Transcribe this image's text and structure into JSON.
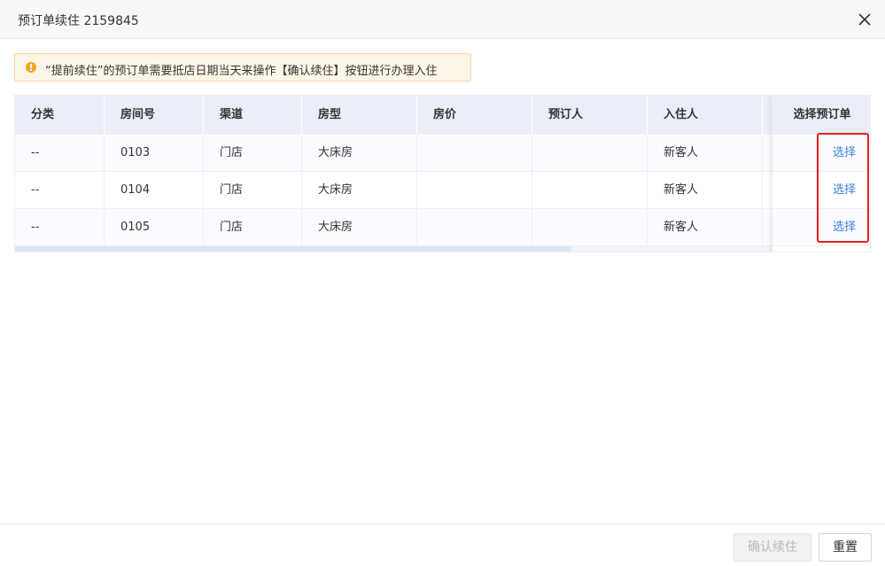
{
  "dialog": {
    "title": "预订单续住 2159845"
  },
  "alert": {
    "text": "“提前续住”的预订单需要抵店日期当天来操作【确认续住】按钮进行办理入住"
  },
  "table": {
    "columns": [
      "分类",
      "房间号",
      "渠道",
      "房型",
      "房价",
      "预订人",
      "入住人"
    ],
    "fixed_column": "选择预订单",
    "rows": [
      {
        "category": "--",
        "room": "0103",
        "channel": "门店",
        "type": "大床房",
        "price": "",
        "booker": "",
        "guest": "新客人",
        "action": "选择"
      },
      {
        "category": "--",
        "room": "0104",
        "channel": "门店",
        "type": "大床房",
        "price": "",
        "booker": "",
        "guest": "新客人",
        "action": "选择"
      },
      {
        "category": "--",
        "room": "0105",
        "channel": "门店",
        "type": "大床房",
        "price": "",
        "booker": "",
        "guest": "新客人",
        "action": "选择"
      }
    ]
  },
  "footer": {
    "confirm_label": "确认续住",
    "reset_label": "重置"
  },
  "colors": {
    "link": "#3d7fe0",
    "highlight": "#e02020",
    "header_bg": "#e9eef8",
    "alert_bg": "#fdf6e6"
  }
}
